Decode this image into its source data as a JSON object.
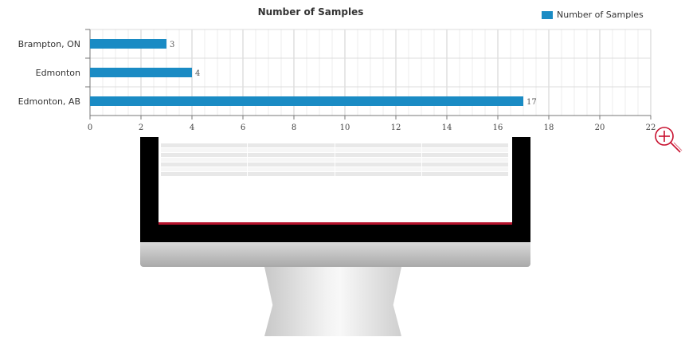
{
  "chart_data": {
    "type": "bar",
    "orientation": "horizontal",
    "title": "Number of Samples",
    "categories": [
      "Brampton, ON",
      "Edmonton",
      "Edmonton, AB"
    ],
    "series": [
      {
        "name": "Number of Samples",
        "values": [
          3,
          4,
          17
        ],
        "color": "#1a8bc4"
      }
    ],
    "xlabel": "",
    "ylabel": "",
    "xlim": [
      0,
      22
    ],
    "xticks": [
      0,
      2,
      4,
      6,
      8,
      10,
      12,
      14,
      16,
      18,
      20,
      22
    ],
    "grid": true,
    "legend_position": "top-right",
    "data_labels": true
  },
  "icons": {
    "zoom": "zoom-in-icon",
    "device": "monitor-icon"
  },
  "colors": {
    "bar": "#1a8bc4",
    "zoom_icon": "#c8102e",
    "screen_accent": "#b5122c"
  }
}
